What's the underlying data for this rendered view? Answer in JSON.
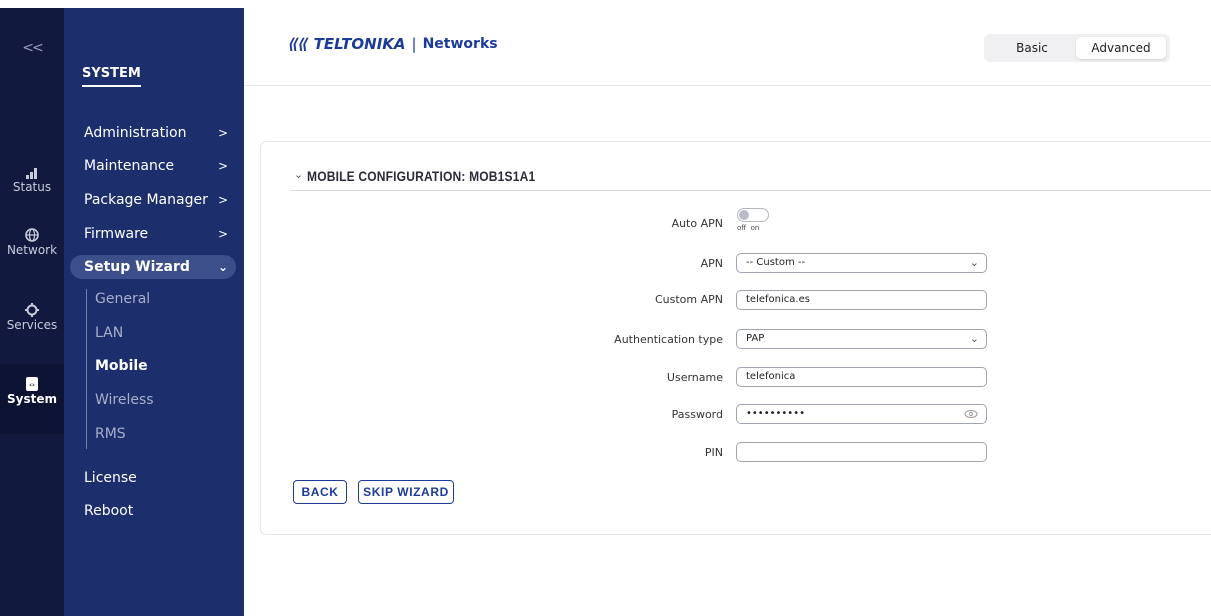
{
  "rail": {
    "collapse_icon": "double-chevron-left-icon",
    "items": [
      {
        "label": "Status",
        "icon": "signal-bars-icon"
      },
      {
        "label": "Network",
        "icon": "globe-icon"
      },
      {
        "label": "Services",
        "icon": "gear-icon"
      },
      {
        "label": "System",
        "icon": "code-file-icon"
      }
    ]
  },
  "subnav": {
    "title": "SYSTEM",
    "items": [
      {
        "label": "Administration",
        "chevron": ">"
      },
      {
        "label": "Maintenance",
        "chevron": ">"
      },
      {
        "label": "Package Manager",
        "chevron": ">"
      },
      {
        "label": "Firmware",
        "chevron": ">"
      },
      {
        "label": "Setup Wizard",
        "chevron": "⌄"
      }
    ],
    "wizard_items": [
      "General",
      "LAN",
      "Mobile",
      "Wireless",
      "RMS"
    ],
    "bottom_items": [
      "License",
      "Reboot"
    ]
  },
  "header": {
    "logo_mark": "⟪⟪",
    "logo_text": "TELTONIKA",
    "logo_sep": "|",
    "logo_sub": "Networks",
    "mode_basic": "Basic",
    "mode_advanced": "Advanced"
  },
  "section": {
    "chevron": "⌄",
    "title": "MOBILE CONFIGURATION: MOB1S1A1"
  },
  "form": {
    "auto_apn": {
      "label": "Auto APN",
      "off": "off",
      "on": "on"
    },
    "apn": {
      "label": "APN",
      "value": "-- Custom --"
    },
    "custom_apn": {
      "label": "Custom APN",
      "value": "telefonica.es"
    },
    "auth_type": {
      "label": "Authentication type",
      "value": "PAP"
    },
    "username": {
      "label": "Username",
      "value": "telefonica"
    },
    "password": {
      "label": "Password",
      "value": "••••••••••"
    },
    "pin": {
      "label": "PIN",
      "value": ""
    }
  },
  "buttons": {
    "back": "BACK",
    "skip": "SKIP WIZARD"
  },
  "colors": {
    "rail_bg": "#12193f",
    "subnav_bg": "#1c2e6b",
    "brand": "#1d3c9a"
  }
}
